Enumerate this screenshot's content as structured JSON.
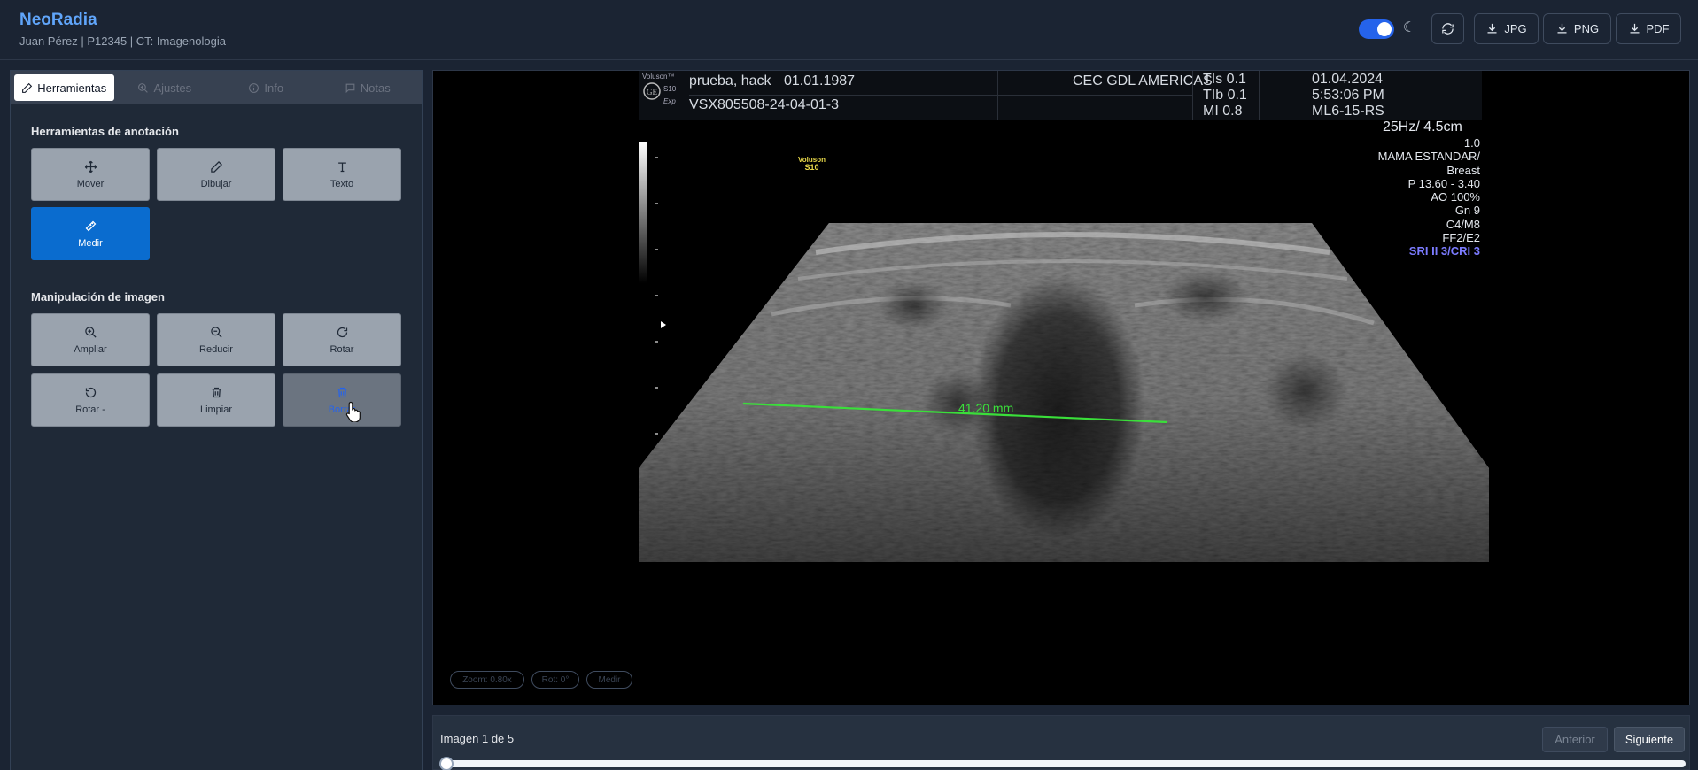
{
  "header": {
    "brand": "NeoRadia",
    "subtitle": "Juan Pérez | P12345 | CT: Imagenologia",
    "dark_mode": true,
    "buttons": {
      "jpg": "JPG",
      "png": "PNG",
      "pdf": "PDF"
    }
  },
  "tabs": [
    {
      "label": "Herramientas",
      "icon": "pencil-icon",
      "active": true
    },
    {
      "label": "Ajustes",
      "icon": "zoom-icon",
      "active": false
    },
    {
      "label": "Info",
      "icon": "info-icon",
      "active": false
    },
    {
      "label": "Notas",
      "icon": "chat-icon",
      "active": false
    }
  ],
  "annotation_tools": {
    "title": "Herramientas de anotación",
    "items": [
      {
        "label": "Mover",
        "icon": "move-icon"
      },
      {
        "label": "Dibujar",
        "icon": "pencil-icon"
      },
      {
        "label": "Texto",
        "icon": "text-icon"
      },
      {
        "label": "Medir",
        "icon": "ruler-icon",
        "active": true
      }
    ]
  },
  "image_tools": {
    "title": "Manipulación de imagen",
    "items": [
      {
        "label": "Ampliar",
        "icon": "zoom-in-icon"
      },
      {
        "label": "Reducir",
        "icon": "zoom-out-icon"
      },
      {
        "label": "Rotar",
        "icon": "rotate-cw-icon"
      },
      {
        "label": "Rotar -",
        "icon": "rotate-ccw-icon"
      },
      {
        "label": "Limpiar",
        "icon": "trash-icon"
      },
      {
        "label": "Borrar",
        "icon": "trash-icon",
        "hovered": true
      }
    ]
  },
  "viewer": {
    "brand_line1": "Voluson™",
    "brand_line2": "S10",
    "brand_line3": "Exp",
    "patient_name": "prueba, hack",
    "patient_dob": "01.01.1987",
    "study_id": "VSX805508-24-04-01-3",
    "institution": "CEC GDL AMERICAS",
    "tis": "TIs  0.1",
    "tib": "TIb  0.1",
    "mi": "MI  0.8",
    "date": "01.04.2024",
    "time": "5:53:06 PM",
    "probe": "ML6-15-RS",
    "freq_depth": "25Hz/ 4.5cm",
    "params": [
      "1.0",
      "MAMA ESTANDAR/",
      "Breast",
      "P 13.60 - 3.40",
      "AO 100%",
      "Gn   9",
      "C4/M8",
      "FF2/E2"
    ],
    "sri": "SRI II 3/CRI 3",
    "badge_line1": "Voluson",
    "badge_line2": "S10",
    "measurement": "41.20 mm",
    "chips": {
      "zoom": "Zoom: 0.80x",
      "rotation": "Rot: 0°",
      "tool": "Medir"
    }
  },
  "bottom": {
    "counter": "Imagen 1 de 5",
    "prev": "Anterior",
    "next": "Siguiente",
    "current": 1,
    "total": 5
  },
  "colors": {
    "accent": "#0a6ccf",
    "brand": "#60a5fa",
    "measure": "#3adf3a",
    "sri": "#7b7bff"
  }
}
